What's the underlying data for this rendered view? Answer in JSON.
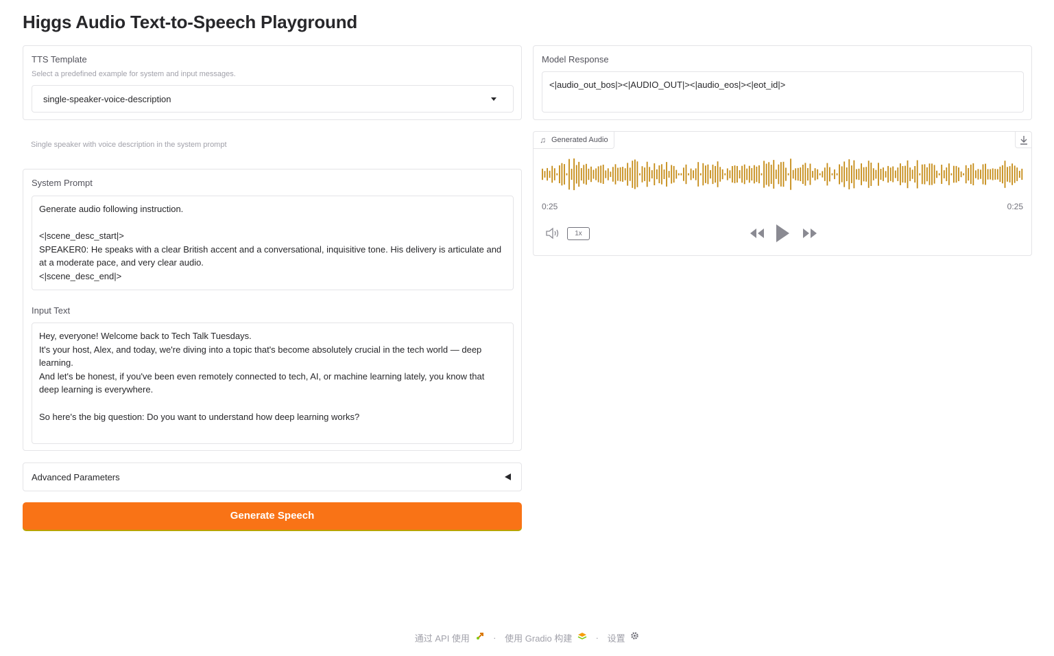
{
  "page_title": "Higgs Audio Text-to-Speech Playground",
  "tts_template": {
    "label": "TTS Template",
    "info": "Select a predefined example for system and input messages.",
    "selected": "single-speaker-voice-description",
    "description": "Single speaker with voice description in the system prompt"
  },
  "system_prompt": {
    "label": "System Prompt",
    "value": "Generate audio following instruction.\n\n<|scene_desc_start|>\nSPEAKER0: He speaks with a clear British accent and a conversational, inquisitive tone. His delivery is articulate and at a moderate pace, and very clear audio.\n<|scene_desc_end|>"
  },
  "input_text": {
    "label": "Input Text",
    "value": "Hey, everyone! Welcome back to Tech Talk Tuesdays.\nIt's your host, Alex, and today, we're diving into a topic that's become absolutely crucial in the tech world — deep learning.\nAnd let's be honest, if you've been even remotely connected to tech, AI, or machine learning lately, you know that deep learning is everywhere.\n\nSo here's the big question: Do you want to understand how deep learning works?"
  },
  "advanced": {
    "label": "Advanced Parameters"
  },
  "generate_button": {
    "label": "Generate Speech"
  },
  "model_response": {
    "label": "Model Response",
    "value": "<|audio_out_bos|><|AUDIO_OUT|><|audio_eos|><|eot_id|>"
  },
  "audio": {
    "label": "Generated Audio",
    "current_time": "0:25",
    "total_time": "0:25",
    "speed": "1x",
    "waveform_color": "#c58a14",
    "icons": [
      "music-note-icon",
      "download-icon",
      "volume-icon",
      "rewind-icon",
      "play-icon",
      "fast-forward-icon"
    ]
  },
  "footer": {
    "api_label": "通过 API 使用",
    "built_label": "使用 Gradio 构建",
    "settings_label": "设置",
    "separator": "·"
  },
  "colors": {
    "accent": "#f97316",
    "border": "#e4e4e7",
    "text": "#27272a",
    "muted": "#a1a1aa"
  }
}
